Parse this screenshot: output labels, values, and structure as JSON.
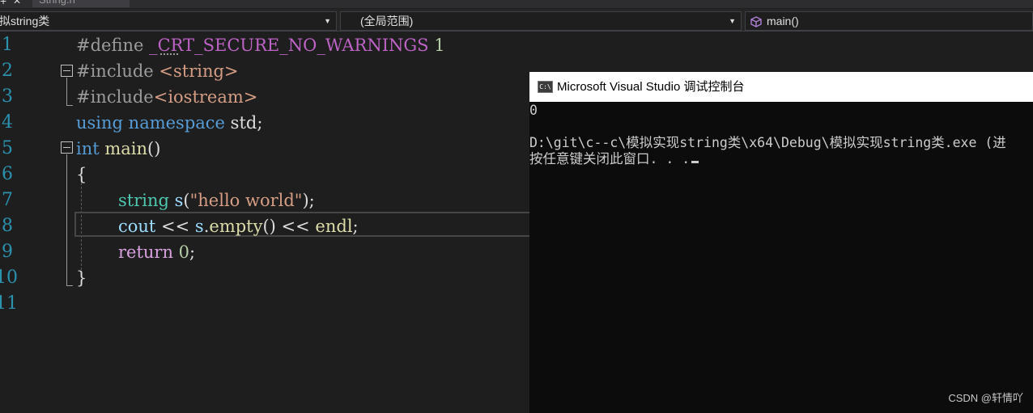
{
  "tabs": {
    "plus": "+",
    "close": "✕",
    "file_tab": "String.h"
  },
  "navbar": {
    "project_scope": "拟string类",
    "global_scope": "(全局范围)",
    "member": "main()"
  },
  "editor": {
    "line_numbers": [
      "1",
      "2",
      "3",
      "4",
      "5",
      "6",
      "7",
      "8",
      "9",
      "10",
      "11"
    ],
    "lines": {
      "l1": {
        "pp": "#define ",
        "macro": "_CRT_SECURE_NO_WARNINGS",
        "num": " 1"
      },
      "l2": {
        "pp": "#include ",
        "str": "<string>"
      },
      "l3": {
        "pp": "#include",
        "str": "<iostream>"
      },
      "l4": {
        "kw1": "using",
        "kw2": " namespace",
        "rest": " std;"
      },
      "l5": {
        "kw": "int",
        "fn": " main",
        "rest": "()"
      },
      "l6": {
        "text": "{"
      },
      "l7": {
        "type": "string",
        "var": " s",
        "p1": "(",
        "str": "\"hello world\"",
        "p2": ");"
      },
      "l8": {
        "var1": "cout",
        "op1": " << ",
        "var2": "s",
        "dot": ".",
        "fn": "empty",
        "op2": "() << ",
        "fn2": "endl",
        "end": ";"
      },
      "l9": {
        "ctl": "return",
        "num": " 0",
        "end": ";"
      },
      "l10": {
        "text": "}"
      }
    }
  },
  "console": {
    "title": "Microsoft Visual Studio 调试控制台",
    "icon_text": "C:\\",
    "output_line1": "0",
    "output_line2": "D:\\git\\c--c\\模拟实现string类\\x64\\Debug\\模拟实现string类.exe (进",
    "output_line3": "按任意键关闭此窗口. . ."
  },
  "watermark": "CSDN @轩情吖",
  "colors": {
    "editor_bg": "#1e1e1e",
    "line_number": "#2b91af",
    "keyword": "#569cd6",
    "string": "#d69d85",
    "type": "#4ec9b0",
    "function": "#dcdcaa",
    "control": "#d8a0df",
    "console_bg": "#0c0c0c"
  }
}
